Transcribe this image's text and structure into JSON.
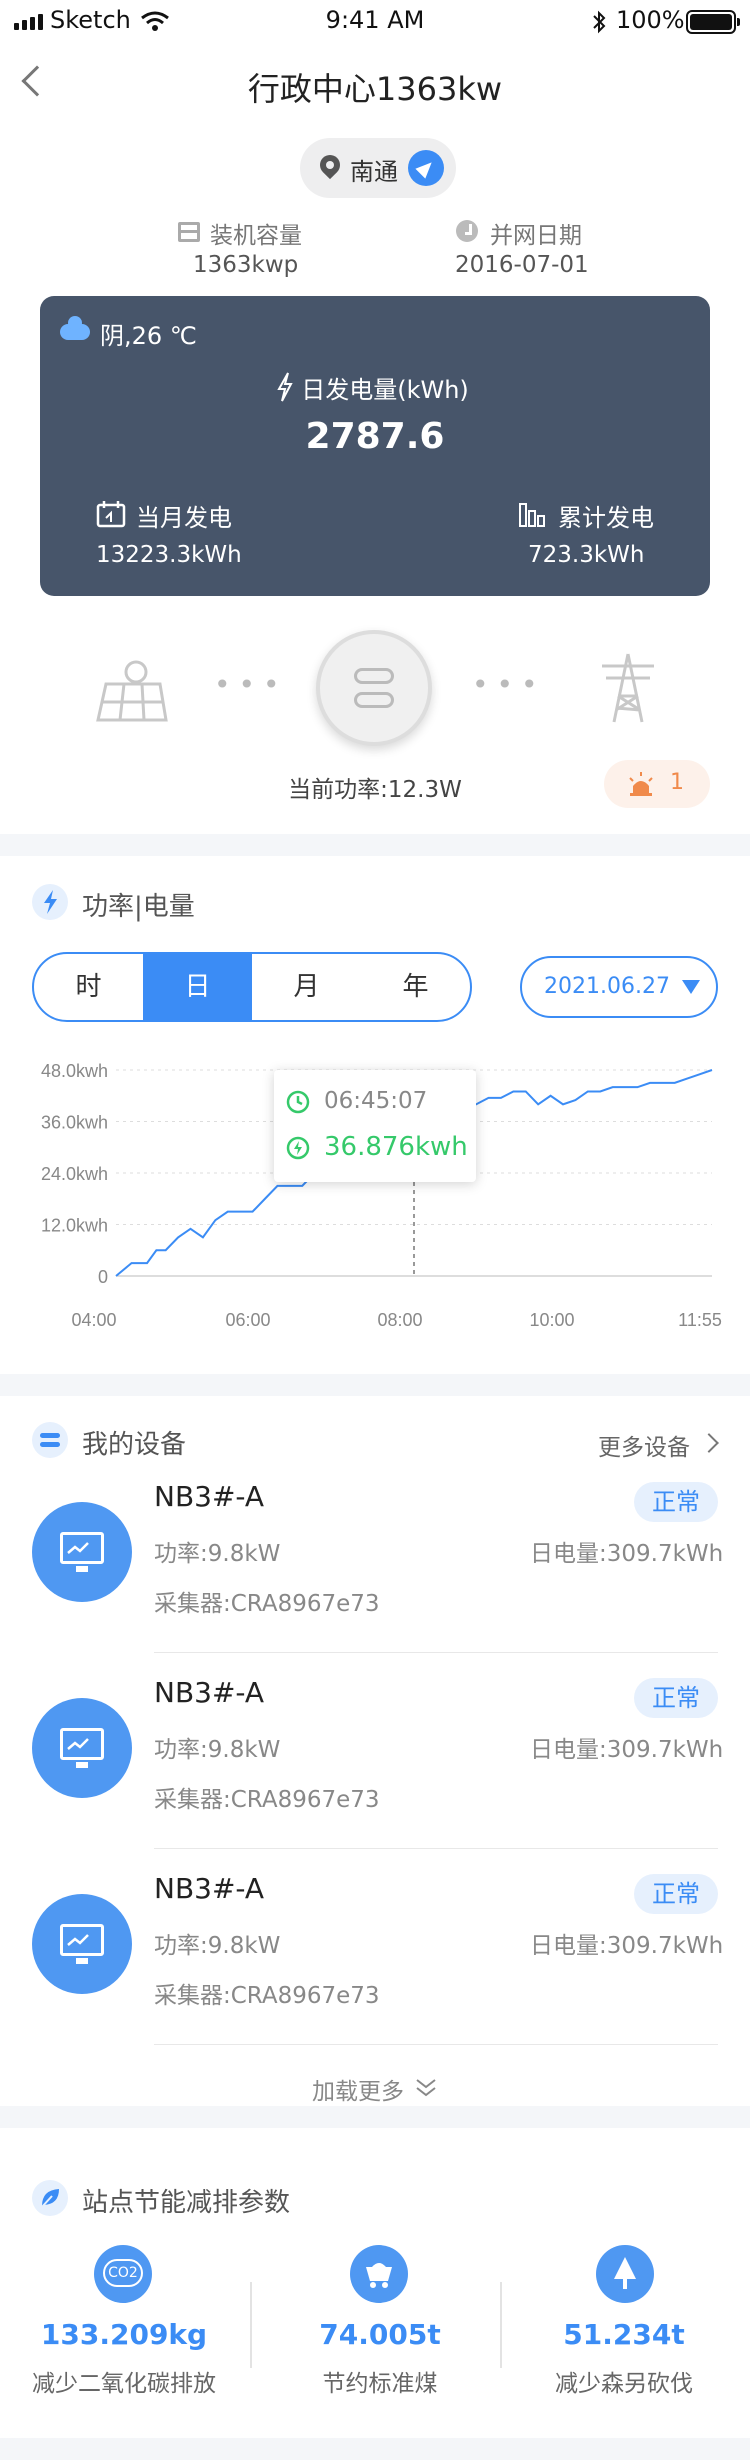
{
  "status": {
    "carrier": "Sketch",
    "time": "9:41 AM",
    "battery": "100%"
  },
  "header": {
    "title": "行政中心1363kw",
    "location": "南通",
    "capacity_label": "装机容量",
    "capacity_value": "1363kwp",
    "grid_date_label": "并网日期",
    "grid_date_value": "2016-07-01"
  },
  "generation": {
    "weather": "阴,26 ℃",
    "daily_label": "日发电量(kWh)",
    "daily_value": "2787.6",
    "monthly_label": "当月发电",
    "monthly_value": "13223.3kWh",
    "total_label": "累计发电",
    "total_value": "723.3kWh"
  },
  "flow": {
    "current_power": "当前功率:12.3W",
    "alarm_count": "1"
  },
  "power": {
    "section_title": "功率|电量",
    "tabs": [
      "时",
      "日",
      "月",
      "年"
    ],
    "active_tab": 1,
    "date": "2021.06.27",
    "tooltip_time": "06:45:07",
    "tooltip_value": "36.876kwh"
  },
  "chart_data": {
    "type": "line",
    "x_labels": [
      "04:00",
      "06:00",
      "08:00",
      "10:00",
      "11:55"
    ],
    "y_labels": [
      "48.0kwh",
      "36.0kwh",
      "24.0kwh",
      "12.0kwh",
      "0"
    ],
    "ylim": [
      0,
      48
    ],
    "x": [
      0,
      0.5,
      1,
      1.3,
      1.6,
      2,
      2.4,
      2.8,
      3.2,
      3.6,
      4,
      4.4,
      4.8,
      5.2,
      5.6,
      6,
      6.4,
      6.8,
      7.2,
      7.6,
      8,
      8.4,
      8.8,
      9.2,
      9.6,
      10,
      10.4,
      10.8,
      11.2,
      11.6,
      12,
      12.4,
      12.8,
      13.2,
      13.6,
      14,
      14.4,
      14.8,
      15.2,
      15.6,
      16,
      16.4,
      16.8,
      17.2,
      17.6,
      18,
      18.4,
      18.8,
      19.2
    ],
    "values": [
      0,
      3,
      3,
      6,
      6,
      9,
      11,
      9,
      13,
      15,
      15,
      15,
      18,
      21,
      21,
      21,
      24,
      26,
      26,
      29,
      32,
      33,
      35,
      35,
      36.9,
      37.5,
      37.5,
      38,
      39,
      40,
      41.5,
      41.5,
      43,
      43,
      40,
      42,
      40,
      41,
      43,
      43,
      44,
      44,
      44,
      45,
      45,
      45,
      46,
      47,
      48
    ],
    "highlight_index": 24,
    "xlim": [
      0,
      19.2
    ],
    "line_color": "#3b8cf5",
    "marker_color": "#35c96a"
  },
  "devices": {
    "section_title": "我的设备",
    "more_label": "更多设备",
    "items": [
      {
        "name": "NB3#-A",
        "status": "正常",
        "power": "功率:9.8kW",
        "daily": "日电量:309.7kWh",
        "collector": "采集器:CRA8967e73"
      },
      {
        "name": "NB3#-A",
        "status": "正常",
        "power": "功率:9.8kW",
        "daily": "日电量:309.7kWh",
        "collector": "采集器:CRA8967e73"
      },
      {
        "name": "NB3#-A",
        "status": "正常",
        "power": "功率:9.8kW",
        "daily": "日电量:309.7kWh",
        "collector": "采集器:CRA8967e73"
      }
    ],
    "load_more": "加载更多"
  },
  "energy": {
    "section_title": "站点节能减排参数",
    "co2_icon": "CO2",
    "items": [
      {
        "value": "133.209kg",
        "label": "减少二氧化碳排放"
      },
      {
        "value": "74.005t",
        "label": "节约标准煤"
      },
      {
        "value": "51.234t",
        "label": "减少森另砍伐"
      }
    ]
  },
  "colors": {
    "accent": "#3b8cf5",
    "card": "#47556a",
    "green": "#35c96a",
    "alarm": "#f08a4b"
  }
}
